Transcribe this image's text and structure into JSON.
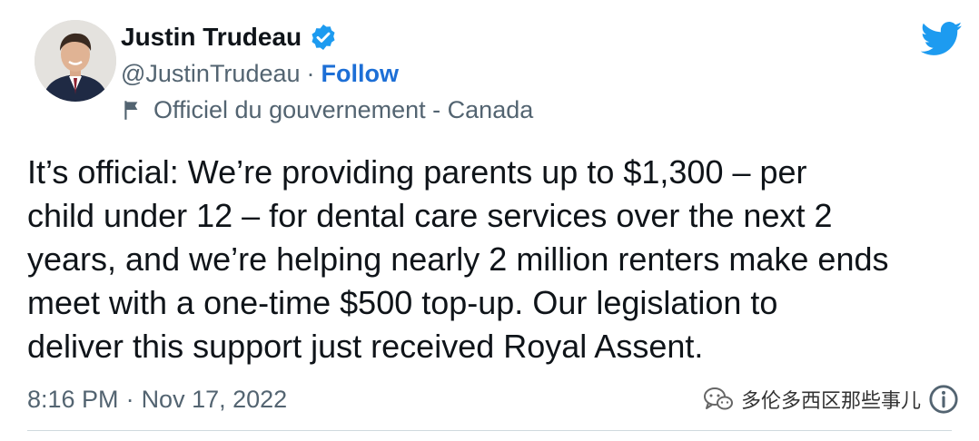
{
  "author": {
    "display_name": "Justin Trudeau",
    "handle": "@JustinTrudeau",
    "separator": "·",
    "follow_label": "Follow",
    "account_label": "Officiel du gouvernement - Canada",
    "verified": true
  },
  "tweet": {
    "text": "It’s official: We’re providing parents up to $1,300 – per\nchild under 12 – for dental care services over the next 2\nyears, and we’re helping nearly 2 million renters make ends\nmeet with a one-time $500 top-up. Our legislation to\ndeliver this support just received Royal Assent.",
    "time": "8:16 PM",
    "separator": "·",
    "date": "Nov 17, 2022"
  },
  "watermark": {
    "text": "多伦多西区那些事儿"
  },
  "icons": {
    "verified": "verified-badge-icon",
    "flag": "flag-icon",
    "brand": "twitter-bird-icon",
    "wechat": "wechat-icon",
    "info": "info-icon"
  },
  "colors": {
    "brand": "#1d9bf0",
    "link": "#1d6fd6",
    "text": "#0f1419",
    "secondary": "#536471",
    "divider": "#cfd9de"
  }
}
